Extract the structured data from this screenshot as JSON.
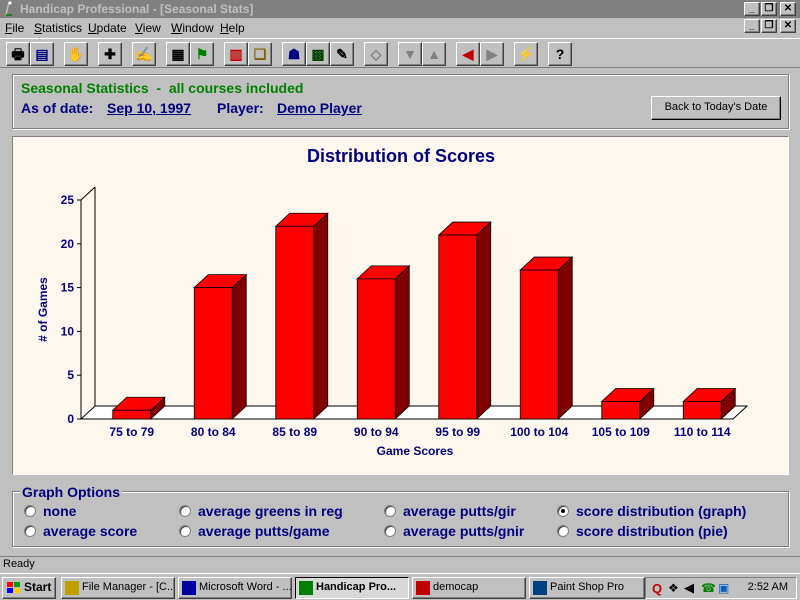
{
  "window": {
    "title": "Handicap Professional - [Seasonal Stats]",
    "min_glyph": "_",
    "restore_glyph": "❐",
    "close_glyph": "✕"
  },
  "menu": [
    {
      "underlined": "F",
      "rest": "ile"
    },
    {
      "underlined": "S",
      "rest": "tatistics"
    },
    {
      "underlined": "U",
      "rest": "pdate"
    },
    {
      "underlined": "V",
      "rest": "iew"
    },
    {
      "underlined": "W",
      "rest": "indow"
    },
    {
      "underlined": "H",
      "rest": "elp"
    }
  ],
  "toolbar": {
    "icons": [
      {
        "name": "print-icon",
        "glyph": "🖶"
      },
      {
        "name": "scorecard-icon",
        "glyph": "▤"
      },
      {
        "name": "stop-hand-icon",
        "glyph": "✋"
      },
      {
        "name": "add-score-icon",
        "glyph": "✚"
      },
      {
        "name": "handshake-icon",
        "glyph": "✍"
      },
      {
        "name": "calendar-icon",
        "glyph": "▦"
      },
      {
        "name": "flag-icon",
        "glyph": "⚑"
      },
      {
        "name": "bar-chart-icon",
        "glyph": "▥"
      },
      {
        "name": "folders-icon",
        "glyph": "❏"
      },
      {
        "name": "runner-icon",
        "glyph": "☗"
      },
      {
        "name": "course-map-icon",
        "glyph": "▩"
      },
      {
        "name": "edit-note-icon",
        "glyph": "✎"
      },
      {
        "name": "eraser-icon",
        "glyph": "◇"
      },
      {
        "name": "down-arrow-icon",
        "glyph": "▼"
      },
      {
        "name": "up-arrow-icon",
        "glyph": "▲"
      },
      {
        "name": "left-arrow-icon",
        "glyph": "◀"
      },
      {
        "name": "right-arrow-icon",
        "glyph": "▶"
      },
      {
        "name": "lightning-icon",
        "glyph": "⚡"
      },
      {
        "name": "help-question-icon",
        "glyph": "?"
      }
    ]
  },
  "header": {
    "title": "Seasonal Statistics  -  all courses included",
    "as_of_label": "As of date:",
    "as_of_value": "Sep 10, 1997",
    "player_label": "Player:",
    "player_value": "Demo Player",
    "back_button": "Back to Today's Date"
  },
  "chart_data": {
    "type": "bar",
    "title": "Distribution of Scores",
    "xlabel": "Game Scores",
    "ylabel": "# of Games",
    "categories": [
      "75 to 79",
      "80 to 84",
      "85 to 89",
      "90 to 94",
      "95 to 99",
      "100 to 104",
      "105 to 109",
      "110 to 114"
    ],
    "values": [
      1,
      15,
      22,
      16,
      21,
      17,
      2,
      2
    ],
    "ylim": [
      0,
      25
    ],
    "yticks": [
      0,
      5,
      10,
      15,
      20,
      25
    ],
    "bar_color": "#ff0000",
    "grid": false,
    "style": "3d"
  },
  "graph_options": {
    "title": "Graph Options",
    "options": [
      {
        "label": "none",
        "selected": false
      },
      {
        "label": "average score",
        "selected": false
      },
      {
        "label": "average greens in reg",
        "selected": false
      },
      {
        "label": "average putts/game",
        "selected": false
      },
      {
        "label": "average putts/gir",
        "selected": false
      },
      {
        "label": "average putts/gnir",
        "selected": false
      },
      {
        "label": "score distribution (graph)",
        "selected": true
      },
      {
        "label": "score distribution (pie)",
        "selected": false
      }
    ]
  },
  "status": {
    "text": "Ready"
  },
  "taskbar": {
    "start": "Start",
    "tasks": [
      {
        "label": "File Manager - [C...",
        "icon": "file-manager-icon",
        "active": false
      },
      {
        "label": "Microsoft Word - ...",
        "icon": "word-icon",
        "active": false
      },
      {
        "label": "Handicap Pro...",
        "icon": "handicap-icon",
        "active": true
      },
      {
        "label": "democap",
        "icon": "democap-icon",
        "active": false
      },
      {
        "label": "Paint Shop Pro",
        "icon": "paint-shop-icon",
        "active": false
      }
    ],
    "clock": "2:52 AM"
  }
}
